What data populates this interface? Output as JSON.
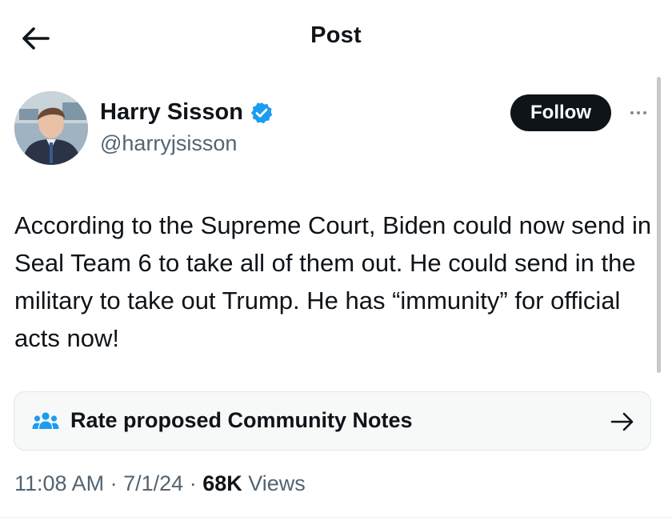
{
  "header": {
    "title": "Post",
    "back_icon": "arrow-left-icon"
  },
  "author": {
    "name": "Harry Sisson",
    "handle": "@harryjsisson",
    "verified": true,
    "verified_color": "#1d9bf0",
    "avatar_icon": "avatar-photo"
  },
  "actions": {
    "follow_label": "Follow",
    "more_icon": "more-horizontal-icon"
  },
  "post": {
    "text": "According to the Supreme Court, Biden could now send in Seal Team 6 to take all of them out. He could send in the military to take out Trump. He has “immunity” for official acts now!"
  },
  "community_notes": {
    "label": "Rate proposed Community Notes",
    "icon": "people-group-icon",
    "arrow_icon": "arrow-right-icon",
    "icon_color": "#1d9bf0"
  },
  "meta": {
    "time": "11:08 AM",
    "separator": "·",
    "date": "7/1/24",
    "views_count": "68K",
    "views_label": "Views"
  },
  "colors": {
    "text": "#0f1419",
    "secondary_text": "#536471",
    "follow_bg": "#0f1419",
    "notes_bg": "#f7f9f9"
  }
}
